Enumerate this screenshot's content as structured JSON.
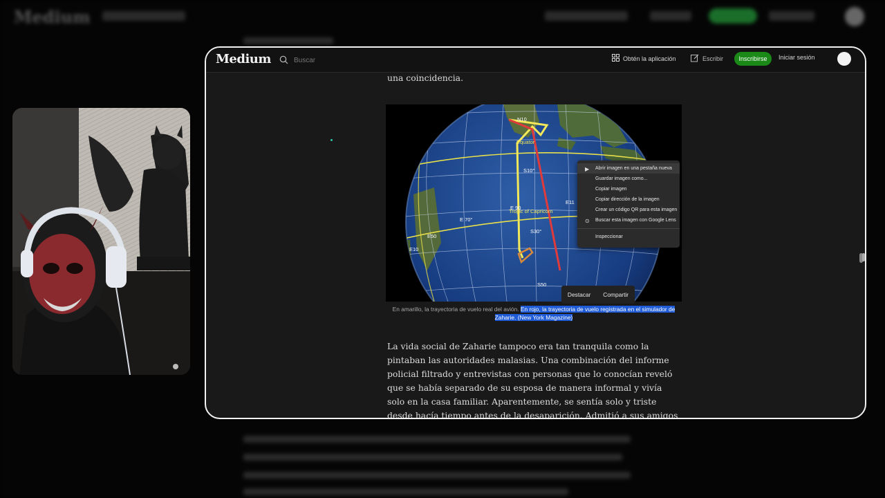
{
  "background_page": {
    "logo": "Medium"
  },
  "header": {
    "logo": "Medium",
    "search_placeholder": "Buscar",
    "get_app_label": "Obtén la aplicación",
    "write_label": "Escribir",
    "signup_label": "Inscribirse",
    "signin_label": "Iniciar sesión"
  },
  "article": {
    "previous_line": "una coincidencia.",
    "figure": {
      "labels": {
        "n10": "N10",
        "equator": "Equator",
        "s10": "S10°",
        "e90": "E 90",
        "e70": "E 70°",
        "tropic": "Tropic of Capricorn",
        "s30": "S30°",
        "e11": "E11",
        "s50": "S50",
        "e50": "E50",
        "e10": "E10"
      },
      "caption_plain": "En amarillo, la trayectoria de vuelo real del avión. ",
      "caption_highlight": "En rojo, la trayectoria de vuelo registrada en el simulador de",
      "caption_end": "Zaharie. (New York Magazine)"
    },
    "paragraph": "La vida social de Zaharie tampoco era tan tranquila como la pintaban las autoridades malasias. Una combinación del informe policial filtrado y entrevistas con personas que lo conocían reveló que se había separado de su esposa de manera informal y vivía solo en la casa familiar. Aparentemente, se sentía solo y triste desde hacía tiempo antes de la desaparición. Admitió a sus amigos que a veces pasaba su tiempo libre dando vueltas por"
  },
  "context_menu": {
    "items": [
      "Abrir imagen en una pestaña nueva",
      "Guardar imagen como...",
      "Copiar imagen",
      "Copiar dirección de la imagen",
      "Crear un código QR para esta imagen",
      "Buscar esta imagen con Google Lens"
    ],
    "inspect": "Inspeccionar"
  },
  "selection_tooltip": {
    "highlight": "Destacar",
    "share": "Compartir"
  },
  "colors": {
    "accent_green": "#1a8917",
    "selection_blue": "#1f5bd6",
    "flight_yellow": "#f3e85a",
    "flight_red": "#e03a3a"
  }
}
